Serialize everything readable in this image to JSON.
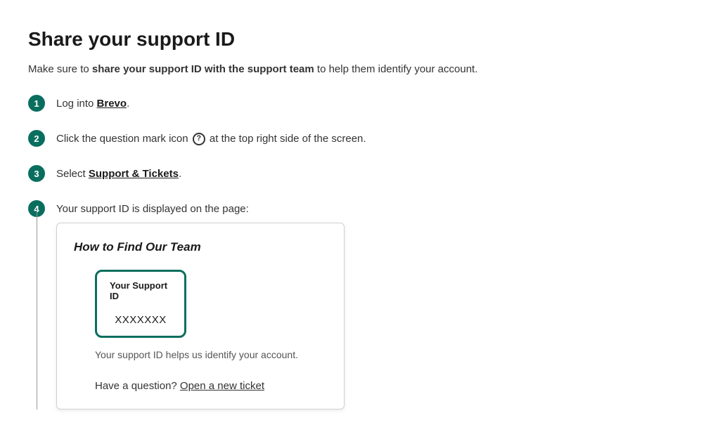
{
  "title": "Share your support ID",
  "intro": {
    "prefix": "Make sure to ",
    "bold": "share your support ID with the support team",
    "suffix": " to help them identify your account."
  },
  "steps": {
    "s1": {
      "num": "1",
      "prefix": "Log into ",
      "link": "Brevo",
      "suffix": "."
    },
    "s2": {
      "num": "2",
      "prefix": "Click the question mark icon ",
      "suffix": " at the top right side of the screen."
    },
    "s3": {
      "num": "3",
      "prefix": "Select ",
      "link": "Support & Tickets",
      "suffix": "."
    },
    "s4": {
      "num": "4",
      "text": "Your support ID is displayed on the page:"
    }
  },
  "card": {
    "title": "How to Find Our Team",
    "box_label": "Your Support ID",
    "box_value": "XXXXXXX",
    "helper": "Your support ID helps us identify your account.",
    "question_prefix": "Have a question? ",
    "question_link": "Open a new ticket"
  }
}
